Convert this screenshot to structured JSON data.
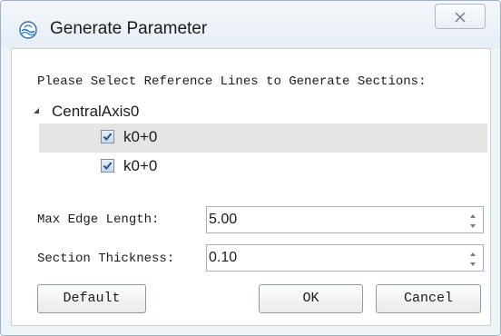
{
  "window": {
    "title": "Generate Parameter",
    "icon": "app-logo-icon"
  },
  "dialog": {
    "prompt": "Please Select Reference Lines to Generate Sections:",
    "tree": {
      "root_label": "CentralAxis0",
      "expanded": true,
      "items": [
        {
          "label": "k0+0",
          "checked": true,
          "selected": true
        },
        {
          "label": "k0+0",
          "checked": true,
          "selected": false
        }
      ]
    },
    "fields": {
      "max_edge_length": {
        "label": "Max Edge Length:",
        "value": "5.00"
      },
      "section_thickness": {
        "label": "Section Thickness:",
        "value": "0.10"
      }
    },
    "buttons": {
      "default": "Default",
      "ok": "OK",
      "cancel": "Cancel"
    }
  },
  "colors": {
    "selection_background": "#e6e5e3",
    "window_frame": "#9db0c6",
    "checkbox_check": "#2b4f86"
  }
}
